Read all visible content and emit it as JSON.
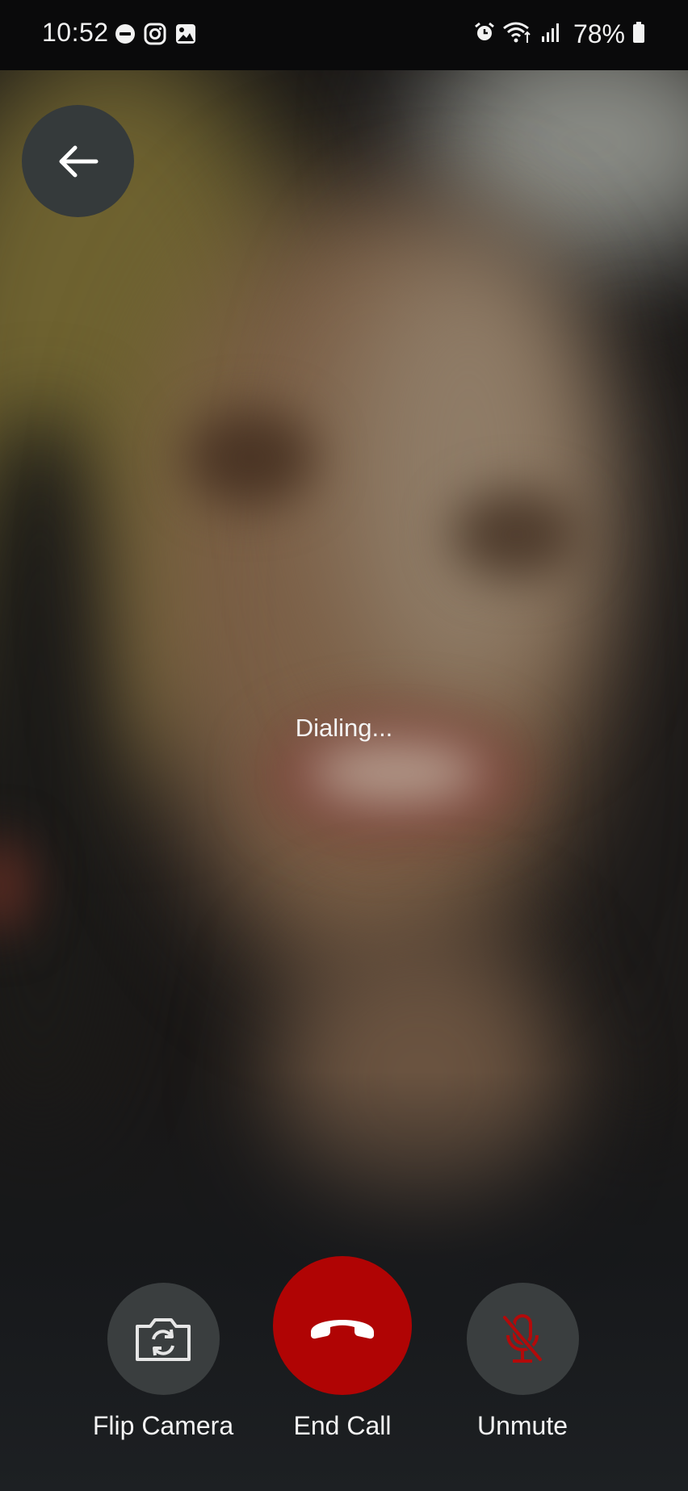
{
  "status_bar": {
    "time": "10:52",
    "left_icons": [
      "do-not-disturb-icon",
      "instagram-icon",
      "gallery-icon"
    ],
    "right_icons": [
      "alarm-icon",
      "wifi-icon",
      "signal-icon",
      "battery-icon"
    ],
    "battery_percent": "78%"
  },
  "call": {
    "status_text": "Dialing..."
  },
  "controls": {
    "flip_camera_label": "Flip Camera",
    "end_call_label": "End Call",
    "unmute_label": "Unmute"
  },
  "colors": {
    "end_call": "#b00404",
    "control_bg": "#3a3e3f",
    "muted_mic": "#b30a0a"
  }
}
